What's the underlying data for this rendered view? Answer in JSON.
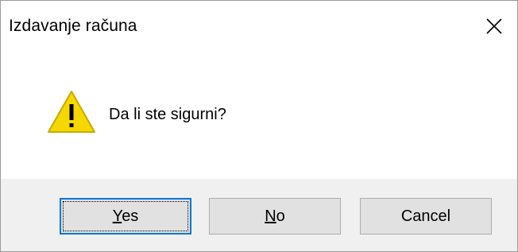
{
  "dialog": {
    "title": "Izdavanje računa",
    "close_icon": "close-icon",
    "message": "Da li ste sigurni?",
    "icon": "warning-icon",
    "colors": {
      "warning_fill": "#f5d800",
      "warning_stroke": "#c9a800",
      "focus_border": "#0078d7",
      "button_bg": "#e1e1e1",
      "footer_bg": "#f0f0f0"
    }
  },
  "buttons": {
    "yes": {
      "mnemonic": "Y",
      "rest": "es"
    },
    "no": {
      "mnemonic": "N",
      "rest": "o"
    },
    "cancel": {
      "label": "Cancel"
    }
  }
}
